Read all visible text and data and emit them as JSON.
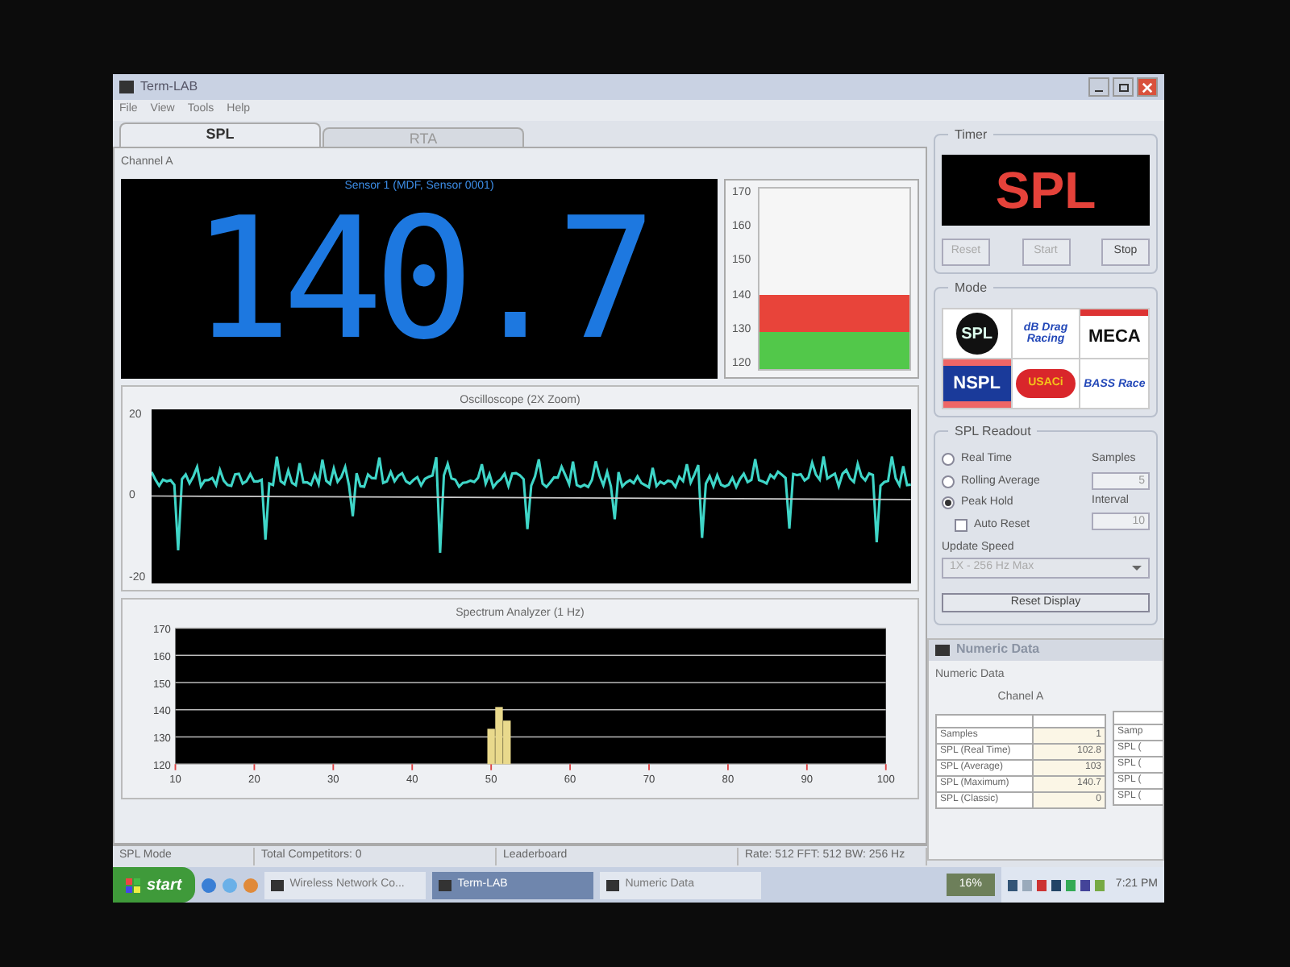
{
  "window": {
    "title": "Term-LAB"
  },
  "menu": [
    "File",
    "View",
    "Tools",
    "Help"
  ],
  "tabs": [
    {
      "label": "SPL",
      "selected": true
    },
    {
      "label": "RTA",
      "selected": false
    }
  ],
  "channel": {
    "title": "Channel A",
    "sensor": "Sensor 1 (MDF, Sensor 0001)",
    "reading": "140.7",
    "meter": {
      "ticks": [
        "170",
        "160",
        "150",
        "140",
        "130",
        "120"
      ],
      "bands": [
        {
          "level": 0.41,
          "color": "#e8443a"
        },
        {
          "level": 0.2,
          "color": "#52c84a"
        }
      ]
    }
  },
  "oscilloscope": {
    "title": "Oscilloscope (2X Zoom)",
    "ticks": [
      "20",
      "0",
      "-20"
    ]
  },
  "spectrum": {
    "title": "Spectrum Analyzer (1 Hz)",
    "chart_data": {
      "type": "bar",
      "x": [
        50,
        51,
        52
      ],
      "values": [
        133,
        141,
        136
      ],
      "xlim": [
        10,
        100
      ],
      "ylim": [
        120,
        170
      ],
      "xticks": [
        10,
        20,
        30,
        40,
        50,
        60,
        70,
        80,
        90,
        100
      ],
      "yticks": [
        120,
        130,
        140,
        150,
        160,
        170
      ],
      "grid": true
    }
  },
  "status_bar": [
    "SPL Mode",
    "Total Competitors: 0",
    "Leaderboard",
    "Rate: 512 FFT: 512 BW: 256 Hz"
  ],
  "timer": {
    "title": "Timer",
    "display": "SPL",
    "buttons": [
      {
        "label": "Reset",
        "disabled": true
      },
      {
        "label": "Start",
        "disabled": true
      },
      {
        "label": "Stop",
        "disabled": false
      }
    ]
  },
  "mode": {
    "title": "Mode",
    "logos": [
      {
        "kind": "circle",
        "text": "SPL"
      },
      {
        "kind": "script",
        "text": "dB Drag Racing"
      },
      {
        "kind": "block",
        "text": "MECA"
      },
      {
        "kind": "stripe",
        "text": "NSPL"
      },
      {
        "kind": "oval",
        "text": "USACi"
      },
      {
        "kind": "script",
        "text": "BASS Race"
      }
    ]
  },
  "readout": {
    "title": "SPL Readout",
    "options": [
      {
        "label": "Real Time",
        "selected": false
      },
      {
        "label": "Rolling Average",
        "selected": false
      },
      {
        "label": "Peak Hold",
        "selected": true
      }
    ],
    "auto_reset": {
      "label": "Auto Reset",
      "checked": false
    },
    "samples": {
      "label": "Samples",
      "value": "5",
      "disabled": true
    },
    "interval": {
      "label": "Interval",
      "value": "10",
      "disabled": true
    },
    "update_speed": {
      "label": "Update Speed",
      "value": "1X - 256 Hz Max",
      "disabled": true
    },
    "reset_button": "Reset Display"
  },
  "numeric_window": {
    "title": "Numeric Data",
    "group": "Numeric Data",
    "channel": "Chanel A",
    "rows": [
      {
        "label": "Samples",
        "value": "1"
      },
      {
        "label": "SPL (Real Time)",
        "value": "102.8"
      },
      {
        "label": "SPL (Average)",
        "value": "103"
      },
      {
        "label": "SPL (Maximum)",
        "value": "140.7"
      },
      {
        "label": "SPL (Classic)",
        "value": "0"
      }
    ],
    "second_table": [
      "Samp",
      "SPL (",
      "SPL (",
      "SPL (",
      "SPL ("
    ]
  },
  "taskbar": {
    "start": "start",
    "tasks": [
      {
        "label": "Wireless Network Co...",
        "selected": false
      },
      {
        "label": "Term-LAB",
        "selected": true
      },
      {
        "label": "Numeric Data",
        "selected": false
      }
    ],
    "indicator": "16%",
    "clock": "7:21 PM"
  }
}
